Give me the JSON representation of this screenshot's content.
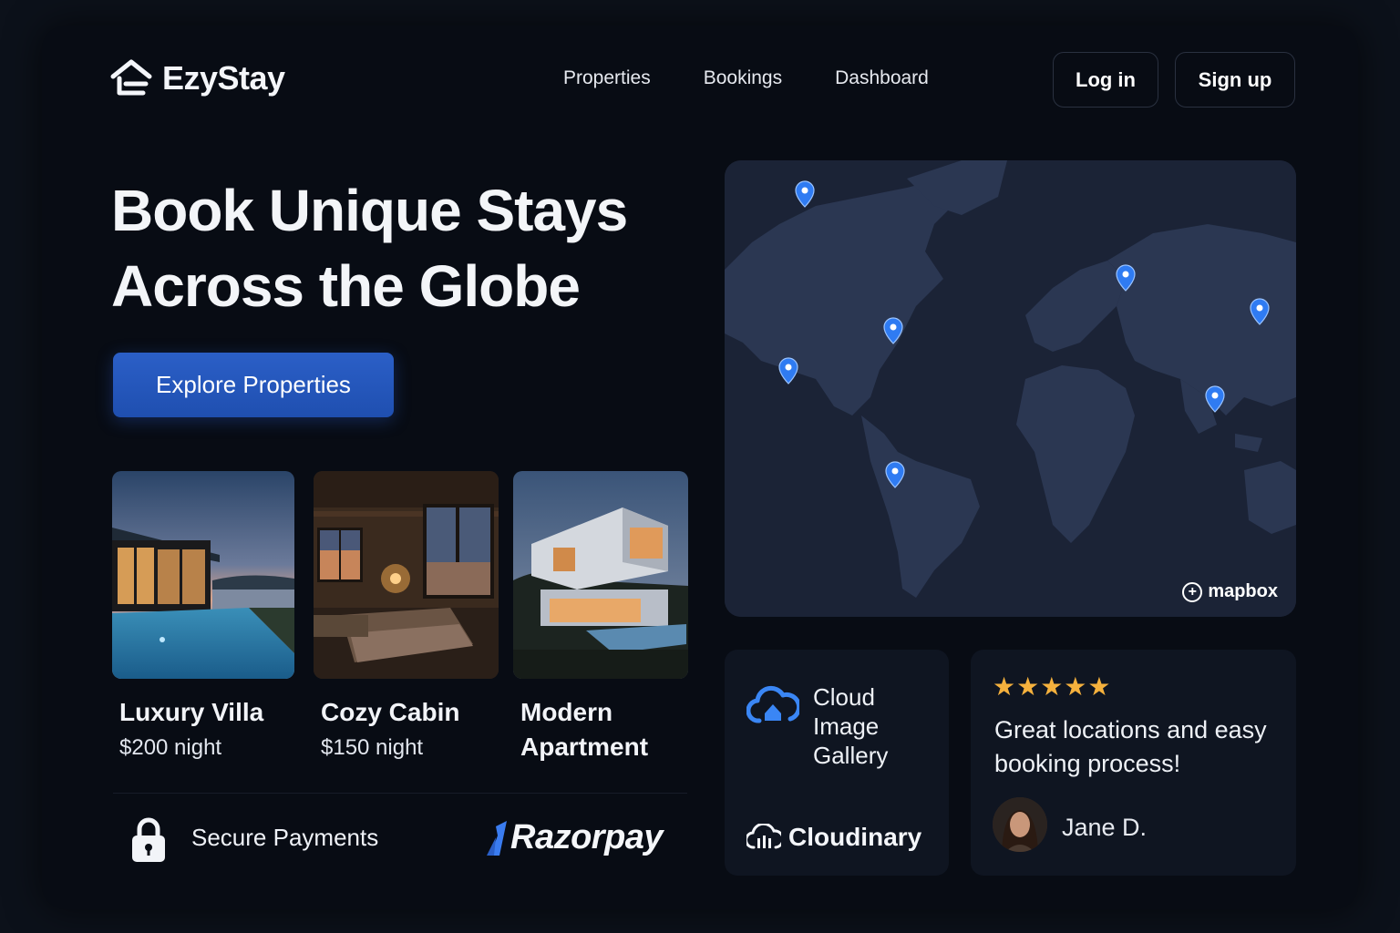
{
  "brand": {
    "name": "EzyStay",
    "logo_icon": "house-icon"
  },
  "nav": {
    "items": [
      {
        "label": "Properties"
      },
      {
        "label": "Bookings"
      },
      {
        "label": "Dashboard"
      }
    ]
  },
  "auth": {
    "login_label": "Log in",
    "signup_label": "Sign up"
  },
  "hero": {
    "title_line1": "Book Unique Stays",
    "title_line2": "Across the Globe",
    "cta_label": "Explore Properties"
  },
  "properties": [
    {
      "name": "Luxury Villa",
      "price": "$200 night"
    },
    {
      "name": "Cozy Cabin",
      "price": "$150 night"
    },
    {
      "name": "Modern Apartment",
      "price": ""
    }
  ],
  "payments": {
    "label": "Secure Payments",
    "provider": "Razorpay",
    "icon": "lock-icon"
  },
  "map": {
    "attribution": "mapbox",
    "pin_icon": "map-pin-icon",
    "pin_count": 7
  },
  "gallery": {
    "title": "Cloud Image Gallery",
    "provider": "Cloudinary",
    "icon": "cloud-upload-icon"
  },
  "review": {
    "stars": "★★★★★",
    "rating": 5,
    "text": "Great locations and easy booking process!",
    "author": "Jane D."
  },
  "colors": {
    "background": "#080c14",
    "accent": "#2b5fc7",
    "star": "#f5b13d",
    "pin": "#2f7bf2",
    "map_land": "#2a3650"
  }
}
